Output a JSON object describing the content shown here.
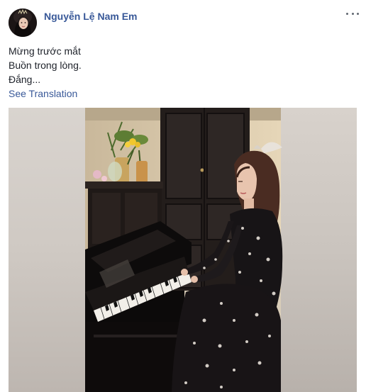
{
  "post": {
    "author": "Nguyễn Lệ Nam Em",
    "avatar_icon": "profile-photo",
    "more_icon": "ellipsis-icon",
    "text_lines": [
      "Mừng trước mắt",
      "Buồn trong lòng.",
      "Đắng..."
    ],
    "see_translation": "See Translation",
    "media": {
      "type": "video",
      "description_icon": "piano-video-thumbnail"
    }
  },
  "colors": {
    "link": "#385898",
    "text": "#1d2129",
    "icon": "#606770"
  }
}
